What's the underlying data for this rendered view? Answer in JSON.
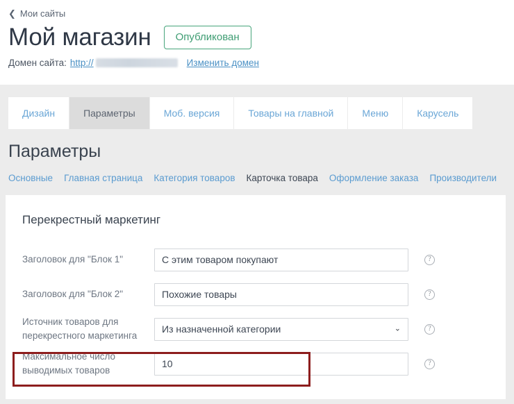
{
  "header": {
    "back_link": "Мои сайты",
    "back_icon": "chevron-left-icon",
    "title": "Мой магазин",
    "status_badge": "Опубликован",
    "domain_label": "Домен сайта:",
    "domain_url": "http://",
    "change_domain_link": "Изменить домен"
  },
  "tabs": [
    {
      "label": "Дизайн",
      "active": false
    },
    {
      "label": "Параметры",
      "active": true
    },
    {
      "label": "Моб. версия",
      "active": false
    },
    {
      "label": "Товары на главной",
      "active": false
    },
    {
      "label": "Меню",
      "active": false
    },
    {
      "label": "Карусель",
      "active": false
    }
  ],
  "section": {
    "title": "Параметры",
    "subnav": [
      {
        "label": "Основные",
        "active": false
      },
      {
        "label": "Главная страница",
        "active": false
      },
      {
        "label": "Категория товаров",
        "active": false
      },
      {
        "label": "Карточка товара",
        "active": true
      },
      {
        "label": "Оформление заказа",
        "active": false
      },
      {
        "label": "Производители",
        "active": false
      }
    ]
  },
  "card": {
    "title": "Перекрестный маркетинг",
    "rows": [
      {
        "label": "Заголовок для \"Блок 1\"",
        "type": "text",
        "value": "С этим товаром покупают",
        "help": "?"
      },
      {
        "label": "Заголовок для \"Блок 2\"",
        "type": "text",
        "value": "Похожие товары",
        "help": "?"
      },
      {
        "label": "Источник товаров для перекрестного маркетинга",
        "type": "select",
        "value": "Из назначенной категории",
        "help": "?"
      },
      {
        "label": "Максимальное число выводимых товаров",
        "type": "text",
        "value": "10",
        "help": "?"
      }
    ]
  },
  "annotation": {
    "highlight_color": "#8d1d1d",
    "target_row_label": "Максимальное число выводимых товаров"
  },
  "icons": {
    "chevron_down": "⌄",
    "chevron_left": "❮",
    "help": "?"
  }
}
